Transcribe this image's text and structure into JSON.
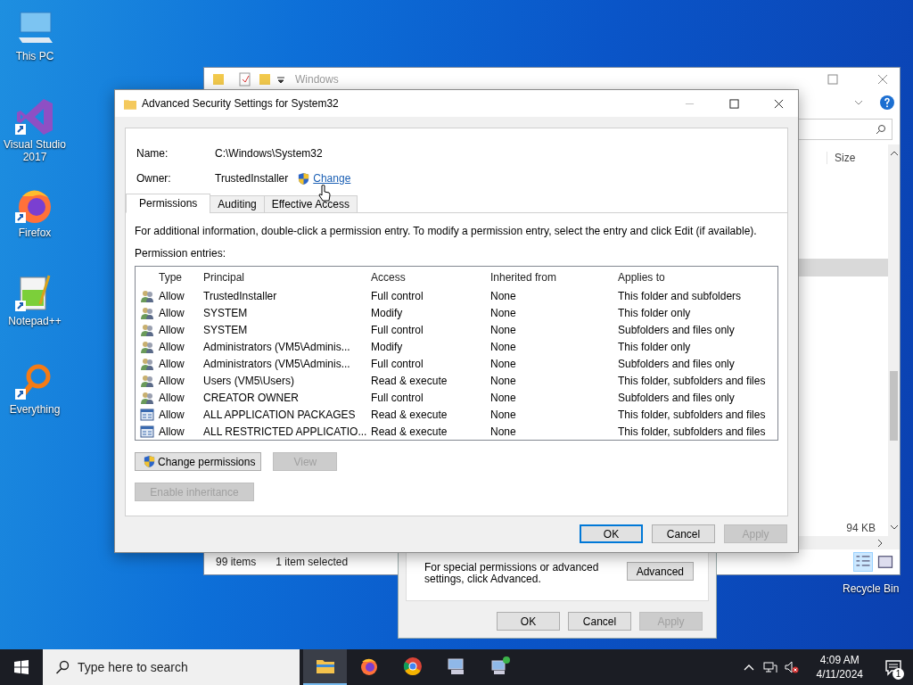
{
  "desktop_icons": [
    {
      "kind": "pc",
      "label": "This PC",
      "shortcut": false
    },
    {
      "kind": "vs",
      "label": "Visual Studio 2017",
      "shortcut": true
    },
    {
      "kind": "firefox",
      "label": "Firefox",
      "shortcut": true
    },
    {
      "kind": "notepad",
      "label": "Notepad++",
      "shortcut": true
    },
    {
      "kind": "everything",
      "label": "Everything",
      "shortcut": true
    }
  ],
  "recycle_bin": {
    "label": "Recycle Bin"
  },
  "explorer": {
    "title": "Windows",
    "column_header": "Size",
    "size_text": "94 KB",
    "status": [
      "99 items",
      "1 item selected"
    ]
  },
  "properties_dialog": {
    "note": "For special permissions or advanced settings, click Advanced.",
    "advanced_button": "Advanced",
    "buttons": [
      {
        "label": "OK",
        "disabled": false
      },
      {
        "label": "Cancel",
        "disabled": false
      },
      {
        "label": "Apply",
        "disabled": true
      }
    ]
  },
  "dialog": {
    "title": "Advanced Security Settings for System32",
    "name_label": "Name:",
    "name_value": "C:\\Windows\\System32",
    "owner_label": "Owner:",
    "owner_value": "TrustedInstaller",
    "owner_link": "Change",
    "tabs": [
      {
        "label": "Permissions",
        "selected": true
      },
      {
        "label": "Auditing",
        "selected": false
      },
      {
        "label": "Effective Access",
        "selected": false
      }
    ],
    "info": "For additional information, double-click a permission entry. To modify a permission entry, select the entry and click Edit (if available).",
    "entries_label": "Permission entries:",
    "columns": [
      "Type",
      "Principal",
      "Access",
      "Inherited from",
      "Applies to"
    ],
    "rows": [
      {
        "kind": "user",
        "type": "Allow",
        "principal": "TrustedInstaller",
        "access": "Full control",
        "inherited": "None",
        "applies": "This folder and subfolders",
        "selected": false
      },
      {
        "kind": "user",
        "type": "Allow",
        "principal": "SYSTEM",
        "access": "Modify",
        "inherited": "None",
        "applies": "This folder only",
        "selected": false
      },
      {
        "kind": "user",
        "type": "Allow",
        "principal": "SYSTEM",
        "access": "Full control",
        "inherited": "None",
        "applies": "Subfolders and files only",
        "selected": false
      },
      {
        "kind": "user",
        "type": "Allow",
        "principal": "Administrators (VM5\\Adminis...",
        "access": "Modify",
        "inherited": "None",
        "applies": "This folder only",
        "selected": false
      },
      {
        "kind": "user",
        "type": "Allow",
        "principal": "Administrators (VM5\\Adminis...",
        "access": "Full control",
        "inherited": "None",
        "applies": "Subfolders and files only",
        "selected": false
      },
      {
        "kind": "user",
        "type": "Allow",
        "principal": "Users (VM5\\Users)",
        "access": "Read & execute",
        "inherited": "None",
        "applies": "This folder, subfolders and files",
        "selected": false
      },
      {
        "kind": "user",
        "type": "Allow",
        "principal": "CREATOR OWNER",
        "access": "Full control",
        "inherited": "None",
        "applies": "Subfolders and files only",
        "selected": false
      },
      {
        "kind": "package",
        "type": "Allow",
        "principal": "ALL APPLICATION PACKAGES",
        "access": "Read & execute",
        "inherited": "None",
        "applies": "This folder, subfolders and files",
        "selected": false
      },
      {
        "kind": "package",
        "type": "Allow",
        "principal": "ALL RESTRICTED APPLICATIO...",
        "access": "Read & execute",
        "inherited": "None",
        "applies": "This folder, subfolders and files",
        "selected": false
      }
    ],
    "change_permissions": {
      "label": "Change permissions",
      "disabled": false
    },
    "view": {
      "label": "View",
      "disabled": true
    },
    "enable_inheritance": {
      "label": "Enable inheritance",
      "disabled": true
    },
    "footer_buttons": [
      {
        "label": "OK",
        "disabled": false,
        "default": true
      },
      {
        "label": "Cancel",
        "disabled": false,
        "default": false
      },
      {
        "label": "Apply",
        "disabled": true,
        "default": false
      }
    ]
  },
  "taskbar": {
    "search_placeholder": "Type here to search",
    "apps": [
      {
        "kind": "explorer",
        "active": true
      },
      {
        "kind": "firefox",
        "active": false
      },
      {
        "kind": "chrome",
        "active": false
      },
      {
        "kind": "computer",
        "active": false
      },
      {
        "kind": "network",
        "active": false
      }
    ],
    "time": "4:09 AM",
    "date": "4/11/2024",
    "notification_count": "1"
  }
}
